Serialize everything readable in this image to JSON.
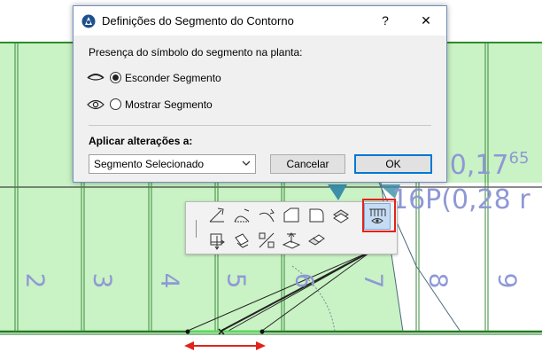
{
  "dialog": {
    "title": "Definições do Segmento do Contorno",
    "help_label": "?",
    "close_label": "✕",
    "presence_label": "Presença do símbolo do segmento na planta:",
    "options": [
      {
        "label": "Esconder Segmento",
        "selected": true,
        "icon": "eye-closed-icon"
      },
      {
        "label": "Mostrar Segmento",
        "selected": false,
        "icon": "eye-open-icon"
      }
    ],
    "apply_label": "Aplicar alterações a:",
    "apply_value": "Segmento Selecionado",
    "cancel_label": "Cancelar",
    "ok_label": "OK"
  },
  "drawing": {
    "tread_numbers": [
      "2",
      "3",
      "4",
      "5",
      "6",
      "7",
      "8",
      "9"
    ],
    "dimension_1_main": "(0,17",
    "dimension_1_sup": "65",
    "dimension_2": "16P(0,28 r"
  },
  "palette": {
    "tools": [
      "edit-segment-icon",
      "curve-segment-icon",
      "arc-segment-icon",
      "chamfer-icon",
      "fillet-icon",
      "offset-icon",
      "segment-visibility-icon",
      "move-node-icon",
      "rotate-icon",
      "split-icon",
      "elevate-icon",
      "duplicate-icon"
    ],
    "active_tool": "segment-visibility-icon"
  },
  "colors": {
    "green_fill": "#c9f2c5",
    "green_line": "#2e8b2e",
    "annotation_blue": "#8f98d6",
    "highlight_red": "#e0231b",
    "arrow_red": "#e0231b"
  }
}
